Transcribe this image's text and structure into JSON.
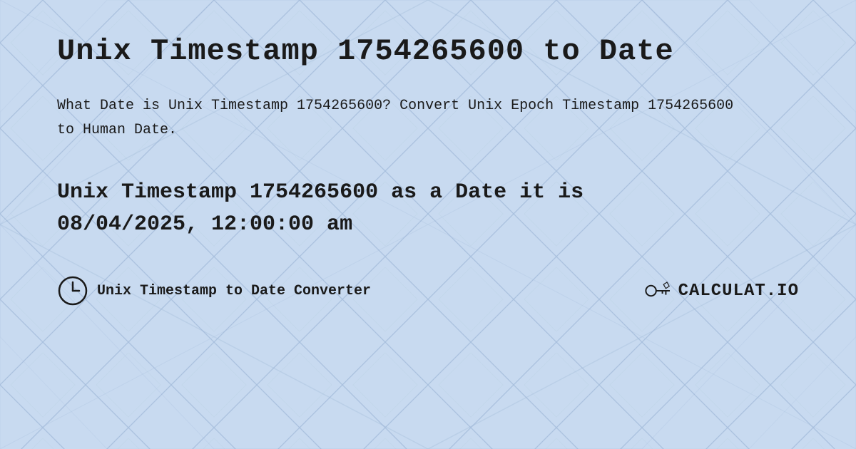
{
  "page": {
    "title": "Unix Timestamp 1754265600 to Date",
    "description": "What Date is Unix Timestamp 1754265600? Convert Unix Epoch Timestamp 1754265600 to Human Date.",
    "result_line1": "Unix Timestamp 1754265600 as a Date it is",
    "result_line2": "08/04/2025, 12:00:00 am",
    "footer": {
      "label": "Unix Timestamp to Date Converter",
      "logo_text": "CALCULAT.IO"
    },
    "colors": {
      "background": "#c8daf0",
      "text": "#1a1a1a",
      "pattern_light": "#b8cfe8",
      "pattern_mid": "#a8bfde"
    }
  }
}
